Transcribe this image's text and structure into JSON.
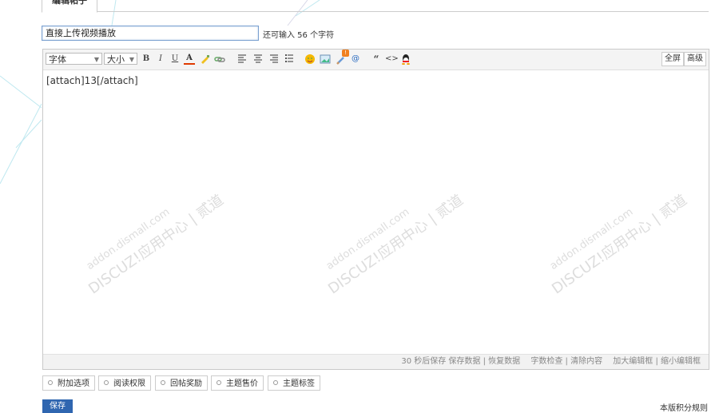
{
  "tab": {
    "label": "编辑帖子"
  },
  "subject": {
    "value": "直接上传视频播放",
    "count_text": "还可输入 56 个字符"
  },
  "toolbar": {
    "font_label": "字体",
    "size_label": "大小",
    "bold": "B",
    "italic": "I",
    "underline": "U",
    "fontcolor": "A",
    "quote": "“",
    "code": "<>",
    "at": "@",
    "fullscreen_label": "全屏",
    "advanced_label": "高级",
    "badge": "!"
  },
  "editor": {
    "content": "[attach]13[/attach]"
  },
  "watermark": {
    "brand": "DISCUZ!应用中心 | 贰道",
    "domain": "addon.dismall.com"
  },
  "statusbar": {
    "autosave": "30 秒后保存 保存数据 | 恢复数据",
    "tools": "字数检查 | 清除内容",
    "resize": "加大编辑框 | 缩小编辑框"
  },
  "options": [
    {
      "label": "附加选项"
    },
    {
      "label": "阅读权限"
    },
    {
      "label": "回帖奖励"
    },
    {
      "label": "主题售价"
    },
    {
      "label": "主题标签"
    }
  ],
  "actions": {
    "save_label": "保存",
    "rules_label": "本版积分规则"
  },
  "colors": {
    "accent": "#2f66b0",
    "border": "#c9c9c9",
    "toolbar_bg": "#f4f4f4"
  }
}
